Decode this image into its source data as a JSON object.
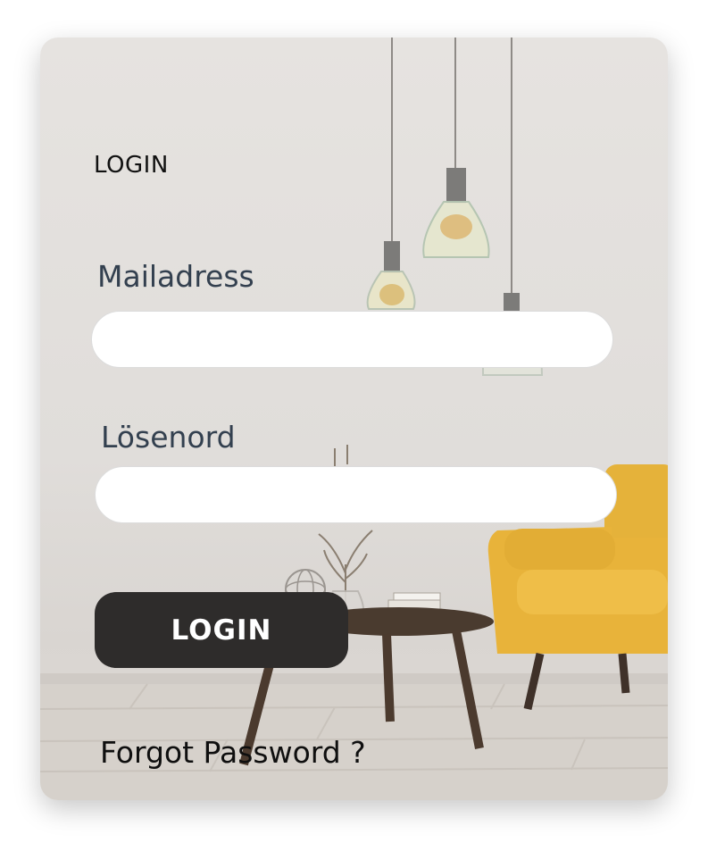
{
  "form": {
    "title": "LOGIN",
    "email_label": "Mailadress",
    "email_value": "",
    "password_label": "Lösenord",
    "password_value": "",
    "login_button_label": "LOGIN",
    "forgot_link": "Forgot Password ?"
  },
  "colors": {
    "button_bg": "#2e2c2b",
    "label_text": "#33404f",
    "chair": "#e8b33a"
  }
}
